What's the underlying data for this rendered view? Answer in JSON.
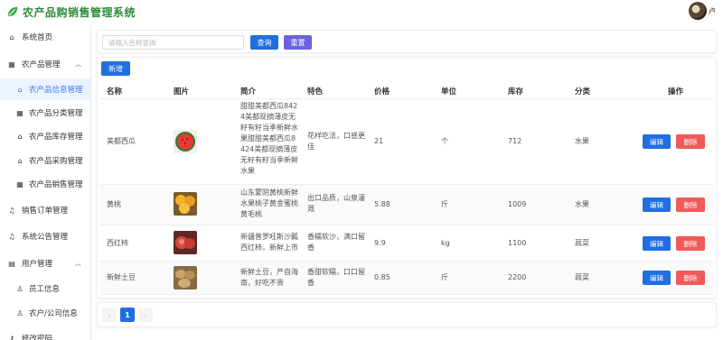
{
  "header": {
    "title": "农产品购销售管理系统",
    "user_name": "卢"
  },
  "sidebar": {
    "items": [
      {
        "label": "系统首页",
        "icon": "home-icon",
        "glyph": "⌂"
      },
      {
        "label": "农产品管理",
        "icon": "grid-icon",
        "glyph": "▦"
      },
      {
        "label": "农产品信息管理",
        "icon": "house-icon",
        "glyph": "⌂"
      },
      {
        "label": "农产品分类管理",
        "icon": "grid-icon",
        "glyph": "▦"
      },
      {
        "label": "农产品库存管理",
        "icon": "house-icon",
        "glyph": "⌂"
      },
      {
        "label": "农产品采购管理",
        "icon": "house-icon",
        "glyph": "⌂"
      },
      {
        "label": "农产品销售管理",
        "icon": "grid-icon",
        "glyph": "▦"
      },
      {
        "label": "销售订单管理",
        "icon": "bell-icon",
        "glyph": "♫"
      },
      {
        "label": "系统公告管理",
        "icon": "bell-icon",
        "glyph": "♫"
      },
      {
        "label": "用户管理",
        "icon": "user-group-icon",
        "glyph": "▤"
      },
      {
        "label": "员工信息",
        "icon": "user-icon",
        "glyph": "♙"
      },
      {
        "label": "农户/公司信息",
        "icon": "user-icon",
        "glyph": "♙"
      },
      {
        "label": "修改密码",
        "icon": "lock-icon",
        "glyph": "⚷"
      }
    ]
  },
  "search": {
    "placeholder": "请输入名称查询",
    "value": "",
    "query_label": "查询",
    "reset_label": "重置"
  },
  "table": {
    "add_label": "新增",
    "headers": [
      "名称",
      "图片",
      "简介",
      "特色",
      "价格",
      "单位",
      "库存",
      "分类",
      "操作"
    ],
    "edit_label": "编辑",
    "delete_label": "删除",
    "rows": [
      {
        "name": "美都西瓜",
        "intro_lines": [
          "甜甜美都西瓜842",
          "4美都现摘薄皮无",
          "籽有籽当季新鲜水",
          "果甜甜美都西瓜8",
          "424美都现摘薄皮",
          "无籽有籽当季新鲜",
          "水果"
        ],
        "feature_lines": [
          "花样吃法，口感更",
          "佳"
        ],
        "price": "21",
        "unit": "个",
        "stock": "712",
        "category": "水果",
        "image": "watermelon"
      },
      {
        "name": "黄桃",
        "intro_lines": [
          "山东蒙阴黄桃新鲜",
          "水果桃子黄金蜜桃",
          "黄毛桃"
        ],
        "feature_lines": [
          "出口品质，山泉灌",
          "溉"
        ],
        "price": "5.88",
        "unit": "斤",
        "stock": "1009",
        "category": "水果",
        "image": "peach"
      },
      {
        "name": "西红柿",
        "intro_lines": [
          "新疆普罗旺斯沙瓤",
          "西红柿，新鲜上市"
        ],
        "feature_lines": [
          "香糯软沙，满口留",
          "香"
        ],
        "price": "9.9",
        "unit": "kg",
        "stock": "1100",
        "category": "蔬菜",
        "image": "tomato"
      },
      {
        "name": "新鲜土豆",
        "intro_lines": [
          "新鲜土豆，产自海",
          "南，好吃不贵"
        ],
        "feature_lines": [
          "香甜软糯，口口留",
          "香"
        ],
        "price": "0.85",
        "unit": "斤",
        "stock": "2200",
        "category": "蔬菜",
        "image": "potato"
      }
    ]
  },
  "pagination": {
    "current_page": "1",
    "prev_glyph": "‹",
    "next_glyph": "›"
  },
  "colors": {
    "primary": "#1f6fe0",
    "danger": "#f05a5a",
    "reset": "#6a62e0",
    "brand_green": "#2e8b3a",
    "active_menu": "#3a7bf2"
  }
}
